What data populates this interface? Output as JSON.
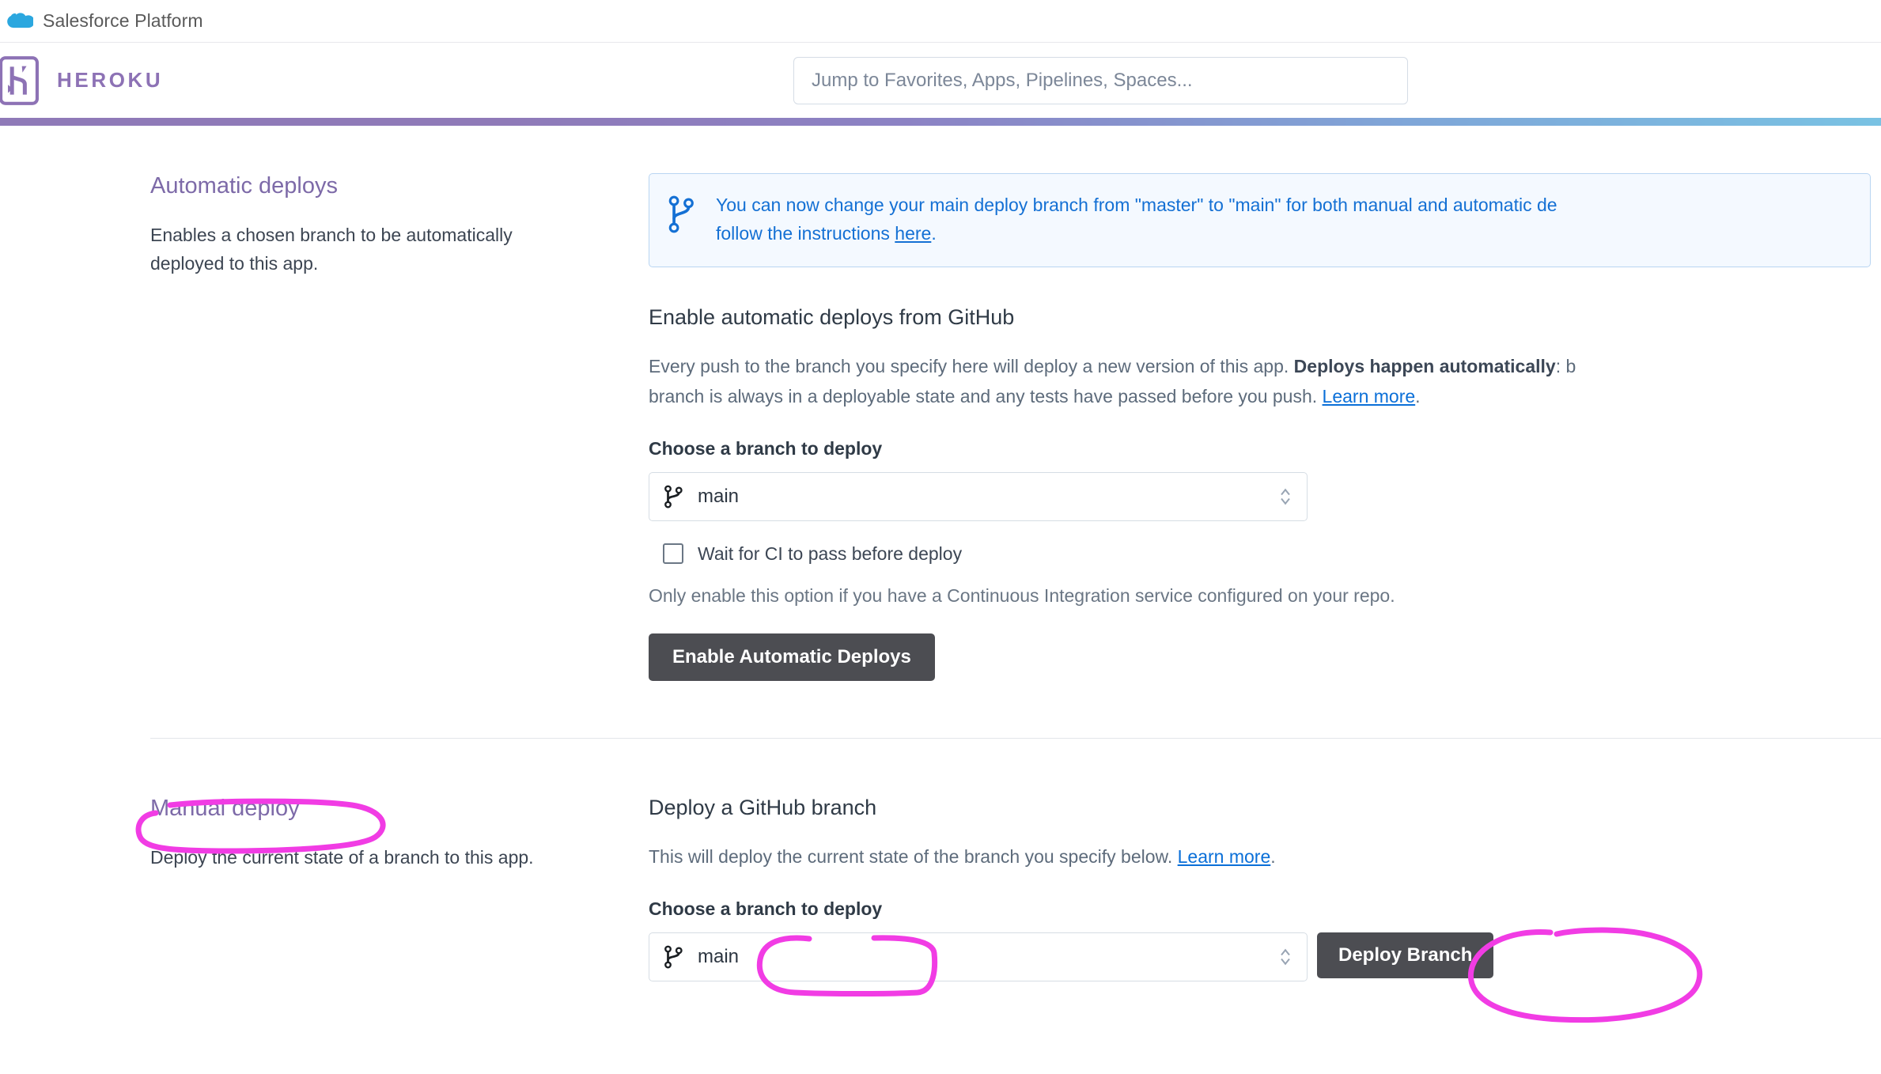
{
  "topbar": {
    "icon": "salesforce-cloud-icon",
    "title": "Salesforce Platform"
  },
  "header": {
    "logo_icon": "heroku-logo-icon",
    "wordmark": "HEROKU",
    "search": {
      "placeholder": "Jump to Favorites, Apps, Pipelines, Spaces...",
      "value": ""
    },
    "gradient_colors": [
      "#8f7ab8",
      "#79c2e3"
    ]
  },
  "banner": {
    "icon": "git-branch-icon",
    "line1": "You can now change your main deploy branch from \"master\" to \"main\" for both manual and automatic de",
    "line2_prefix": "follow the instructions ",
    "line2_link": "here",
    "line2_suffix": ".",
    "accent_color": "#1470d4",
    "background_color": "#f4f9ff"
  },
  "automatic_deploys": {
    "heading": "Automatic deploys",
    "description": "Enables a chosen branch to be automatically deployed to this app.",
    "sub_heading": "Enable automatic deploys from GitHub",
    "body_line1_a": "Every push to the branch you specify here will deploy a new version of this app. ",
    "body_line1_bold": "Deploys happen automatically",
    "body_line1_b": ": b",
    "body_line2_a": "branch is always in a deployable state and any tests have passed before you push. ",
    "body_line2_link": "Learn more",
    "body_line2_b": ".",
    "branch_label": "Choose a branch to deploy",
    "branch_icon": "git-branch-icon",
    "branch_value": "main",
    "checkbox_label": "Wait for CI to pass before deploy",
    "checkbox_checked": false,
    "hint": "Only enable this option if you have a Continuous Integration service configured on your repo.",
    "button_label": "Enable Automatic Deploys"
  },
  "manual_deploy": {
    "heading": "Manual deploy",
    "description": "Deploy the current state of a branch to this app.",
    "sub_heading": "Deploy a GitHub branch",
    "body_a": "This will deploy the current state of the branch you specify below. ",
    "body_link": "Learn more",
    "body_b": ".",
    "branch_label": "Choose a branch to deploy",
    "branch_icon": "git-branch-icon",
    "branch_value": "main",
    "button_label": "Deploy Branch"
  },
  "annotations": {
    "color": "#f13ce4",
    "items": [
      "manual-deploy-heading-circle",
      "manual-branch-select-circle",
      "deploy-branch-button-circle"
    ]
  }
}
